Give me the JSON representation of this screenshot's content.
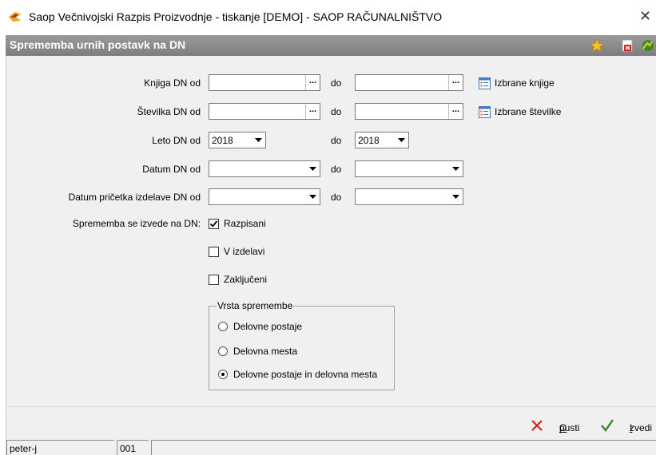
{
  "window": {
    "title": "Saop  Večnivojski Razpis Proizvodnje - tiskanje [DEMO] - SAOP RAČUNALNIŠTVO",
    "app_icon": "saop-logo-icon",
    "close_icon": "close-icon"
  },
  "header": {
    "title": "Sprememba urnih postavk na DN",
    "icons": [
      "star-icon",
      "pdf-delete-icon",
      "exit-icon"
    ]
  },
  "form": {
    "knjiga": {
      "label": "Knjiga DN od",
      "from_value": "",
      "to_label": "do",
      "to_value": "",
      "button": "...",
      "link_label": "Izbrane knjige"
    },
    "stevilka": {
      "label": "Številka DN od",
      "from_value": "",
      "to_label": "do",
      "to_value": "",
      "button": "...",
      "link_label": "Izbrane številke"
    },
    "leto": {
      "label": "Leto DN od",
      "from_value": "2018",
      "to_label": "do",
      "to_value": "2018"
    },
    "datum": {
      "label": "Datum DN od",
      "from_value": "",
      "to_label": "do",
      "to_value": ""
    },
    "datum_pricetka": {
      "label": "Datum pričetka izdelave DN od",
      "from_value": "",
      "to_label": "do",
      "to_value": ""
    },
    "sprememba_label": "Sprememba se izvede na DN:",
    "checkboxes": [
      {
        "label": "Razpisani",
        "checked": true
      },
      {
        "label": "V izdelavi",
        "checked": false
      },
      {
        "label": "Zaključeni",
        "checked": false
      }
    ],
    "vrsta": {
      "title": "Vrsta spremembe",
      "options": [
        {
          "label": "Delovne postaje",
          "selected": false
        },
        {
          "label": "Delovna mesta",
          "selected": false
        },
        {
          "label": "Delovne postaje in delovna mesta",
          "selected": true
        }
      ]
    }
  },
  "buttons": {
    "cancel_accel": "O",
    "cancel_rest": "pusti",
    "run_accel": "I",
    "run_rest": "zvedi"
  },
  "status": {
    "user": "peter-j",
    "code": "001"
  },
  "colors": {
    "header_bg": "#8a8a8a",
    "panel_bg": "#f0f0f0",
    "cancel_red": "#d42020",
    "run_green": "#2e8b1e"
  }
}
